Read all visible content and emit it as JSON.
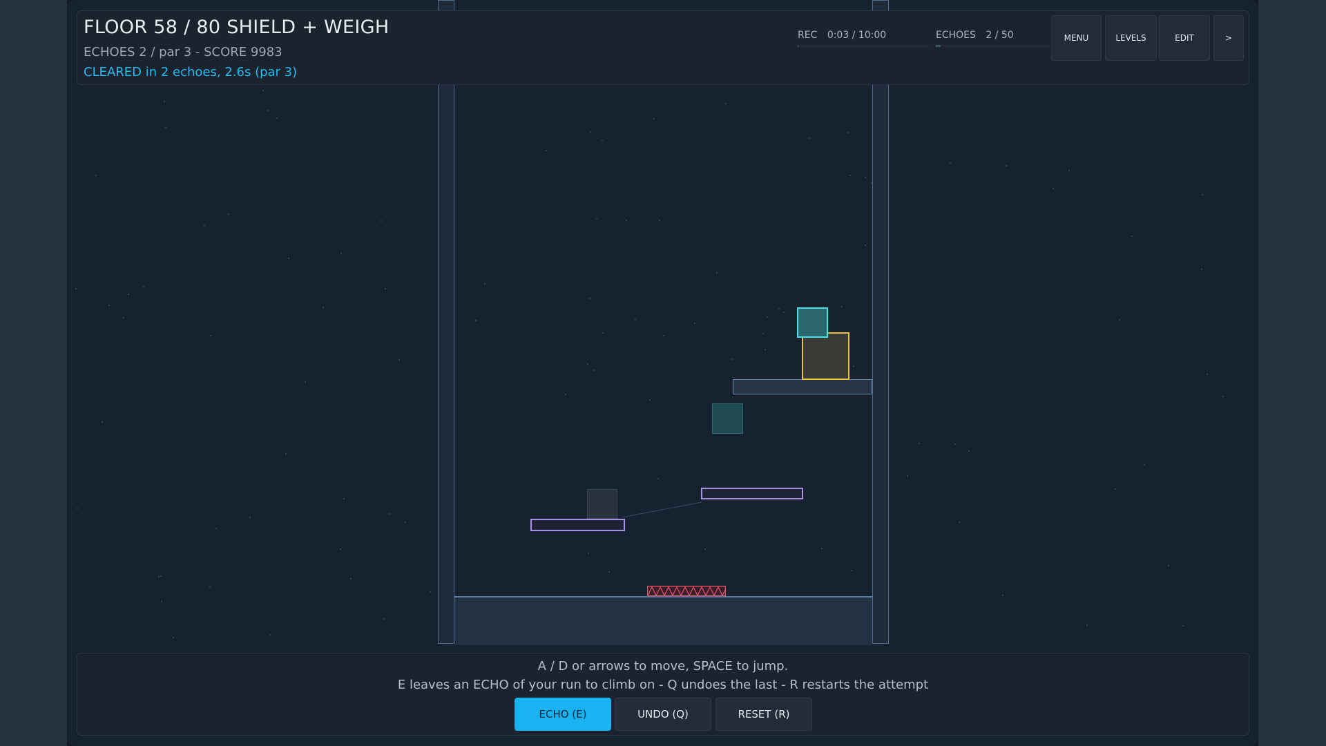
{
  "hud": {
    "title": "FLOOR 58 / 80   SHIELD + WEIGH",
    "stats": "ECHOES 2 / par 3   -   SCORE 9983",
    "status": "CLEARED in 2 echoes, 2.6s   (par 3)",
    "rec_label": "REC",
    "rec_value": "0:03 / 10:00",
    "rec_progress": 0.005,
    "echoes_label": "ECHOES",
    "echoes_value": "2 / 50",
    "echoes_progress": 0.04,
    "buttons": {
      "menu": "MENU",
      "levels": "LEVELS",
      "edit": "EDIT",
      "next": ">"
    }
  },
  "help": {
    "line1": "A / D or arrows to move, SPACE to jump.",
    "line2": "E leaves an ECHO of your run to climb on  -  Q undoes the last  -  R restarts the attempt",
    "echo_button": "ECHO (E)",
    "undo_button": "UNDO (Q)",
    "reset_button": "RESET (R)"
  },
  "colors": {
    "background": "#172230",
    "accent": "#19b3f2",
    "platform_outline": "#a892e2",
    "player": "#46e4e6",
    "weight": "#f0c438",
    "spikes": "#e5536a"
  }
}
